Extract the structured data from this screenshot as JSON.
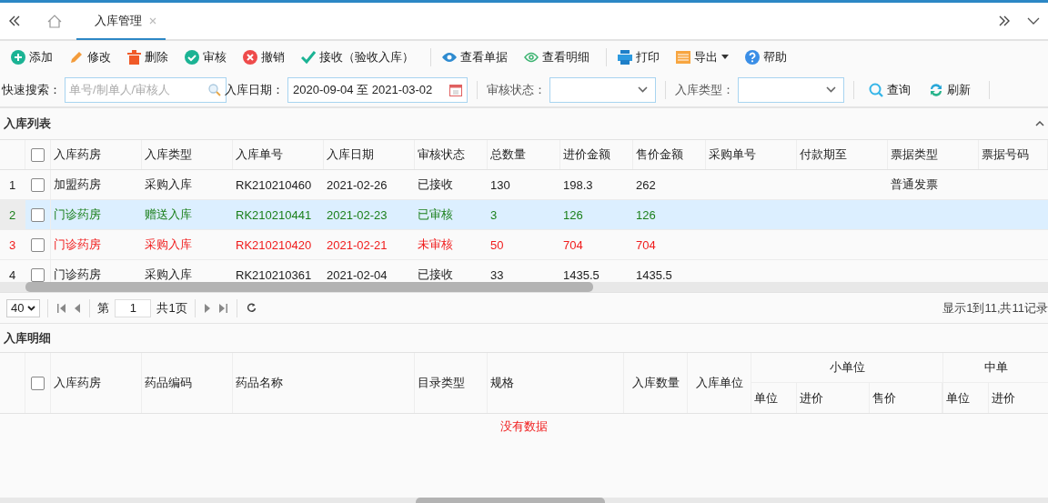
{
  "tabs_bar": {
    "tabs": [
      {
        "label": "入库管理",
        "selected": true
      }
    ]
  },
  "toolbar": [
    [
      {
        "label": "添加",
        "kind": "add"
      },
      {
        "label": "修改",
        "kind": "edit"
      },
      {
        "label": "删除",
        "kind": "delete"
      },
      {
        "label": "审核",
        "kind": "approve"
      },
      {
        "label": "撤销",
        "kind": "cancel"
      },
      {
        "label": "接收（验收入库）",
        "kind": "receive"
      }
    ],
    [
      {
        "label": "查看单据",
        "kind": "view"
      },
      {
        "label": "查看明细",
        "kind": "detail"
      }
    ],
    [
      {
        "label": "打印",
        "kind": "print"
      },
      {
        "label": "导出",
        "kind": "export"
      },
      {
        "label": "帮助",
        "kind": "help"
      }
    ]
  ],
  "filters": {
    "quick_search": {
      "label": "快速搜索：",
      "placeholder": "单号/制单人/审核人"
    },
    "date": {
      "label": "入库日期：",
      "value": "2020-09-04 至 2021-03-02"
    },
    "status": {
      "label": "审核状态："
    },
    "type": {
      "label": "入库类型："
    },
    "buttons": [
      {
        "label": "查询",
        "kind": "query"
      },
      {
        "label": "刷新",
        "kind": "refresh"
      }
    ]
  },
  "list": {
    "title": "入库列表",
    "header_checked": false,
    "columns": [
      "入库药房",
      "入库类型",
      "入库单号",
      "入库日期",
      "审核状态",
      "总数量",
      "进价金额",
      "售价金额",
      "采购单号",
      "付款期至",
      "票据类型",
      "票据号码"
    ],
    "rows": [
      {
        "index": "1",
        "checked": false,
        "selected": false,
        "color": "#222222",
        "cells": [
          "加盟药房",
          "采购入库",
          "RK210210460",
          "2021-02-26",
          "已接收",
          "130",
          "198.3",
          "262",
          "",
          "",
          "普通发票",
          ""
        ]
      },
      {
        "index": "2",
        "checked": false,
        "selected": true,
        "color": "#1a7f1a",
        "cells": [
          "门诊药房",
          "赠送入库",
          "RK210210441",
          "2021-02-23",
          "已审核",
          "3",
          "126",
          "126",
          "",
          "",
          "",
          ""
        ]
      },
      {
        "index": "3",
        "checked": false,
        "selected": false,
        "color": "#f01c1c",
        "cells": [
          "门诊药房",
          "采购入库",
          "RK210210420",
          "2021-02-21",
          "未审核",
          "50",
          "704",
          "704",
          "",
          "",
          "",
          ""
        ]
      },
      {
        "index": "4",
        "checked": false,
        "selected": false,
        "color": "#222222",
        "cells": [
          "门诊药房",
          "采购入库",
          "RK210210361",
          "2021-02-04",
          "已接收",
          "33",
          "1435.5",
          "1435.5",
          "",
          "",
          "",
          ""
        ]
      }
    ]
  },
  "pager": {
    "page_size": "40",
    "page_label": "第",
    "page": "1",
    "total_pages": "共1页",
    "summary": "显示1到11,共11记录"
  },
  "detail": {
    "title": "入库明细",
    "header_checked": false,
    "columns": [
      "入库药房",
      "药品编码",
      "药品名称",
      "目录类型",
      "规格",
      "入库数量",
      "入库单位"
    ],
    "groups": [
      {
        "label": "小单位",
        "columns": [
          "单位",
          "进价",
          "售价"
        ]
      },
      {
        "label": "中单",
        "columns": [
          "单位",
          "进价"
        ]
      }
    ],
    "empty_text": "没有数据"
  }
}
